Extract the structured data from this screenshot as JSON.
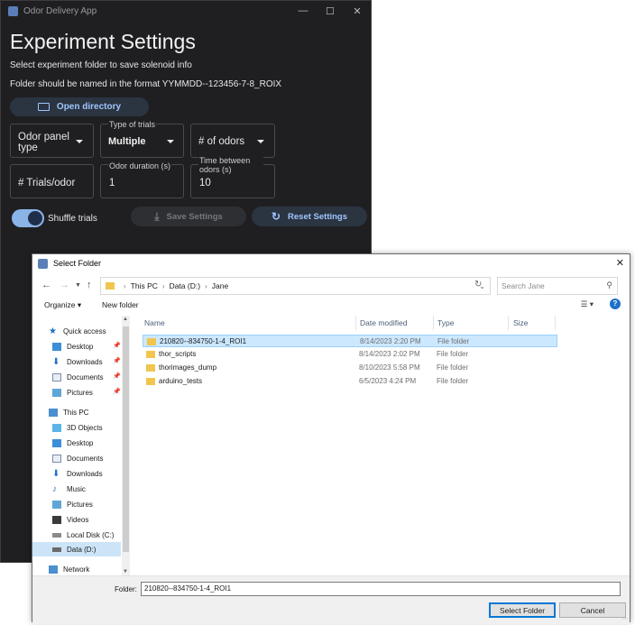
{
  "app": {
    "title": "Odor Delivery App",
    "heading": "Experiment Settings",
    "instruction": "Select experiment folder to save solenoid info",
    "format_note": "Folder should be named in the format YYMMDD--123456-7-8_ROIX",
    "open_directory": "Open directory",
    "fields": {
      "odor_panel_type": "Odor panel type",
      "type_of_trials_label": "Type of trials",
      "type_of_trials_value": "Multiple",
      "num_odors": "# of odors",
      "trials_per_odor": "# Trials/odor",
      "odor_duration_label": "Odor duration (s)",
      "odor_duration_value": "1",
      "time_between_label": "Time between odors (s)",
      "time_between_value": "10"
    },
    "shuffle_label": "Shuffle trials",
    "shuffle_on": true,
    "save_settings": "Save Settings",
    "reset_settings": "Reset Settings"
  },
  "dialog": {
    "title": "Select Folder",
    "breadcrumb": [
      "This PC",
      "Data (D:)",
      "Jane"
    ],
    "search_placeholder": "Search Jane",
    "organize": "Organize",
    "new_folder": "New folder",
    "nav": {
      "quick_access": "Quick access",
      "desktop": "Desktop",
      "downloads": "Downloads",
      "documents": "Documents",
      "pictures": "Pictures",
      "this_pc": "This PC",
      "objects3d": "3D Objects",
      "desktop2": "Desktop",
      "documents2": "Documents",
      "downloads2": "Downloads",
      "music": "Music",
      "pictures2": "Pictures",
      "videos": "Videos",
      "local_disk": "Local Disk (C:)",
      "data_d": "Data (D:)",
      "network": "Network"
    },
    "columns": [
      "Name",
      "Date modified",
      "Type",
      "Size"
    ],
    "files": [
      {
        "name": "210820--834750-1-4_ROI1",
        "date": "8/14/2023 2:20 PM",
        "type": "File folder"
      },
      {
        "name": "thor_scripts",
        "date": "8/14/2023 2:02 PM",
        "type": "File folder"
      },
      {
        "name": "thorimages_dump",
        "date": "8/10/2023 5:58 PM",
        "type": "File folder"
      },
      {
        "name": "arduino_tests",
        "date": "6/5/2023 4:24 PM",
        "type": "File folder"
      }
    ],
    "folder_label": "Folder:",
    "folder_value": "210820--834750-1-4_ROI1",
    "select_button": "Select Folder",
    "cancel_button": "Cancel"
  }
}
